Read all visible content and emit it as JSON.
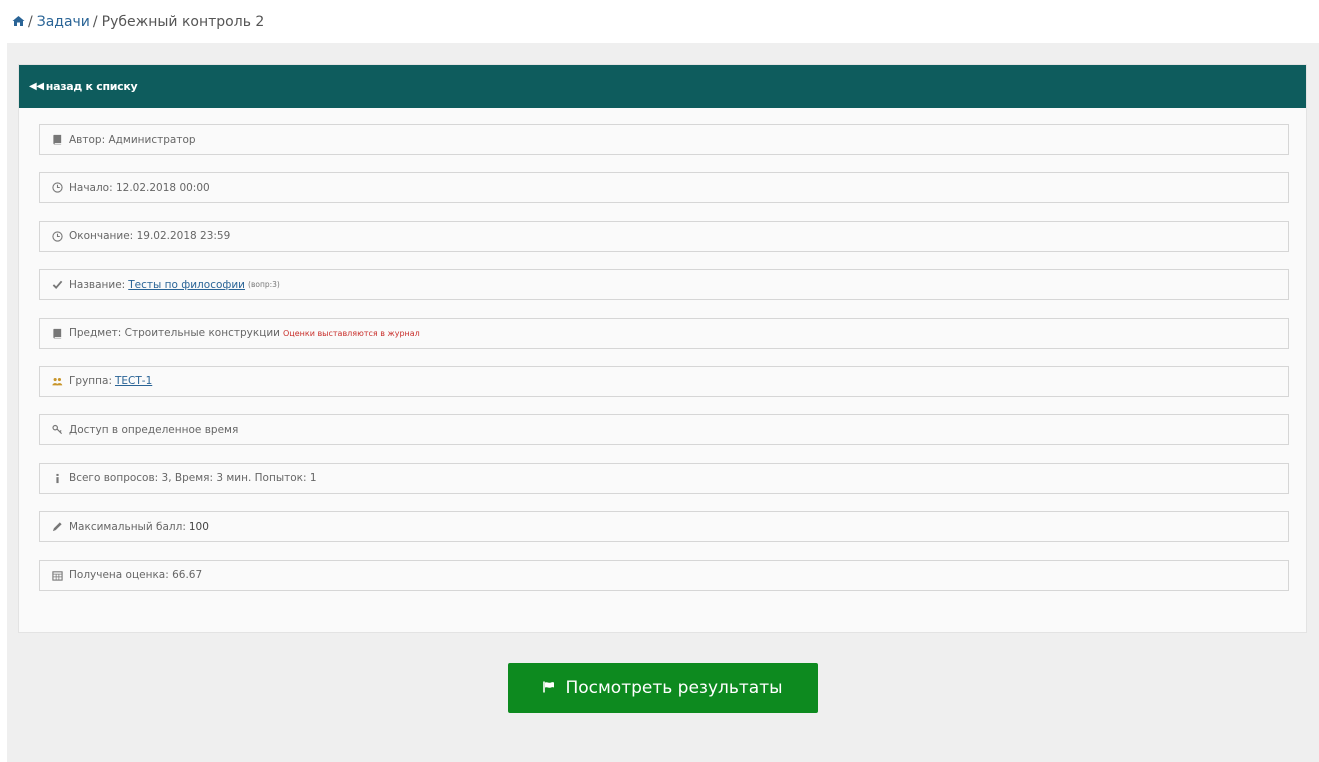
{
  "breadcrumb": {
    "home_icon": "home-icon",
    "items": [
      {
        "label": "Задачи",
        "link": true
      },
      {
        "label": "Рубежный контроль 2",
        "link": false
      }
    ],
    "separator": "/"
  },
  "panel": {
    "back_label": "назад к списку",
    "back_icon": "backward-icon"
  },
  "info": {
    "author": {
      "icon": "book-icon",
      "label": "Автор:",
      "value": "Администратор"
    },
    "start": {
      "icon": "clock-icon",
      "label": "Начало:",
      "value": "12.02.2018 00:00"
    },
    "end": {
      "icon": "clock-icon",
      "label": "Окончание:",
      "value": "19.02.2018 23:59"
    },
    "name": {
      "icon": "check-icon",
      "label": "Название:",
      "value": "Тесты по философии",
      "note": "(вопр:3)"
    },
    "subject": {
      "icon": "book-icon",
      "label": "Предмет:",
      "value": "Строительные конструкции",
      "note": "Оценки выставляются в журнал"
    },
    "group": {
      "icon": "users-icon",
      "label": "Группа:",
      "value": "ТЕСТ-1"
    },
    "access": {
      "icon": "key-icon",
      "label": "Доступ в определенное время"
    },
    "summary": {
      "icon": "info-icon",
      "label": "Всего вопросов: 3, Время: 3 мин. Попыток: 1"
    },
    "max_score": {
      "icon": "pencil-icon",
      "label": "Максимальный балл:",
      "value": "100"
    },
    "grade": {
      "icon": "calendar-icon",
      "label": "Получена оценка:",
      "value": "66.67"
    }
  },
  "actions": {
    "results_label": "Посмотреть результаты",
    "results_icon": "flag-icon",
    "button_color": "#0d8a1f"
  },
  "colors": {
    "header": "#0e5c5d",
    "link": "#2a6496",
    "warning": "#c9302c"
  }
}
